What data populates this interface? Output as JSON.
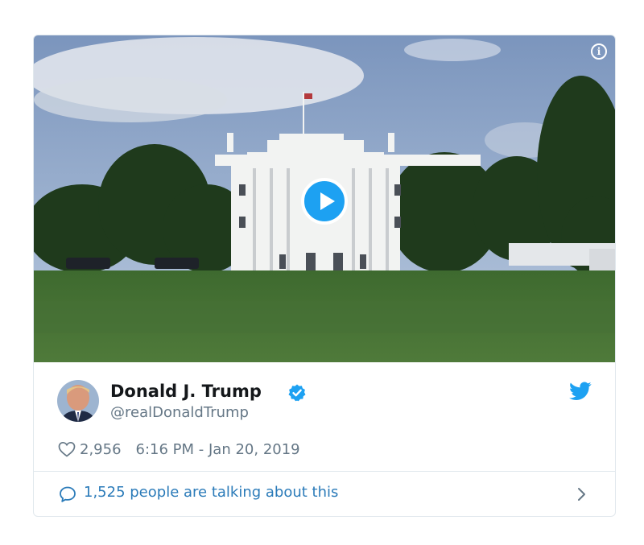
{
  "tweet": {
    "media": {
      "type": "video",
      "info_icon": "info-icon",
      "play_icon": "play-icon"
    },
    "author": {
      "display_name": "Donald J. Trump",
      "handle": "@realDonaldTrump",
      "verified": true,
      "verified_icon": "verified-badge-icon",
      "brand_icon": "twitter-bird-icon"
    },
    "likes": "2,956",
    "timestamp": "6:16 PM - Jan 20, 2019",
    "conversation": {
      "text": "1,525 people are talking about this"
    }
  },
  "colors": {
    "accent": "#1da1f2",
    "link": "#2b7bb9",
    "secondary_text": "#657786",
    "primary_text": "#14171a",
    "border": "#e1e8ed"
  }
}
